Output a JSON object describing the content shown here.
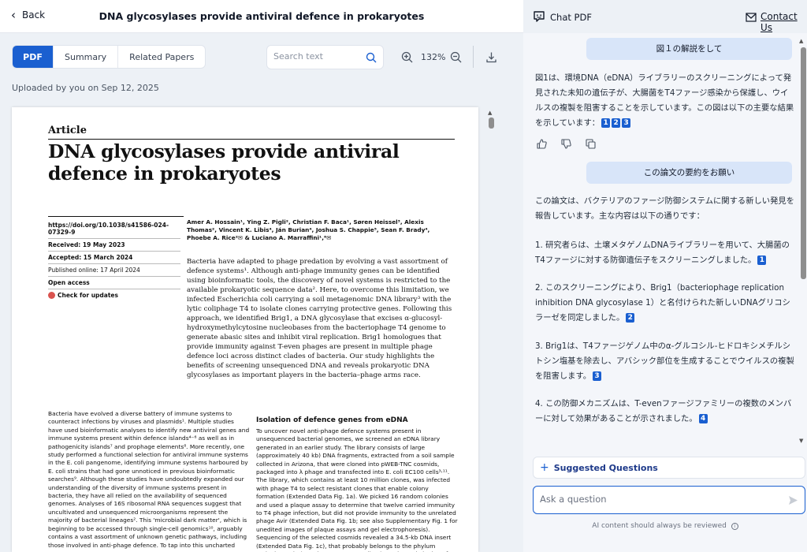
{
  "header": {
    "back_label": "Back",
    "doc_title": "DNA glycosylases provide antiviral defence in prokaryotes"
  },
  "tabs": [
    {
      "label": "PDF",
      "active": true
    },
    {
      "label": "Summary",
      "active": false
    },
    {
      "label": "Related Papers",
      "active": false
    }
  ],
  "toolbar": {
    "search_placeholder": "Search text",
    "zoom_level": "132%"
  },
  "uploaded_text": "Uploaded by you on Sep 12, 2025",
  "paper": {
    "article_label": "Article",
    "title": "DNA glycosylases provide antiviral defence in prokaryotes",
    "doi": "https://doi.org/10.1038/s41586-024-07329-9",
    "received": "Received: 19 May 2023",
    "accepted": "Accepted: 15 March 2024",
    "published": "Published online: 17 April 2024",
    "open_access": "Open access",
    "check_updates": "Check for updates",
    "authors": "Amer A. Hossain¹, Ying Z. Pigli², Christian F. Baca¹, Søren Heissel³, Alexis Thomas², Vincent K. Libis⁴, Ján Burian⁴, Joshua S. Chappie⁵, Sean F. Brady⁴, Phoebe A. Rice²✉ & Luciano A. Marraffini¹,⁶✉",
    "abstract": "Bacteria have adapted to phage predation by evolving a vast assortment of defence systems¹. Although anti-phage immunity genes can be identified using bioinformatic tools, the discovery of novel systems is restricted to the available prokaryotic sequence data². Here, to overcome this limitation, we infected Escherichia coli carrying a soil metagenomic DNA library³ with the lytic coliphage T4 to isolate clones carrying protective genes. Following this approach, we identified Brig1, a DNA glycosylase that excises α-glucosyl-hydroxymethylcytosine nucleobases from the bacteriophage T4 genome to generate abasic sites and inhibit viral replication. Brig1 homologues that provide immunity against T-even phages are present in multiple phage defence loci across distinct clades of bacteria. Our study highlights the benefits of screening unsequenced DNA and reveals prokaryotic DNA glycosylases as important players in the bacteria–phage arms race.",
    "col1": "Bacteria have evolved a diverse battery of immune systems to counteract infections by viruses and plasmids¹. Multiple studies have used bioinformatic analyses to identify new antiviral genes and immune systems present within defence islands⁴⁻⁶ as well as in pathogenicity islands⁷ and prophage elements⁸. More recently, one study performed a functional selection for antiviral immune systems in the E. coli pangenome, identifying immune systems harboured by E. coli strains that had gone unnoticed in previous bioinformatic searches⁹. Although these studies have undoubtedly expanded our understanding of the diversity of immune systems present in bacteria, they have all relied on the availability of sequenced genomes. Analyses of 16S ribosomal RNA sequences suggest that uncultivated and unsequenced microorganisms represent the majority of bacterial lineages². This 'microbial dark matter', which is beginning to be accessed through single-cell genomics¹⁰, arguably contains a vast assortment of unknown genetic pathways, including those involved in anti-phage defence. To tap into this uncharted sequence space,",
    "col2_heading": "Isolation of defence genes from eDNA",
    "col2": "To uncover novel anti-phage defence systems present in unsequenced bacterial genomes, we screened an eDNA library generated in an earlier study. The library consists of large (approximately 40 kb) DNA fragments, extracted from a soil sample collected in Arizona, that were cloned into pWEB-TNC cosmids, packaged into λ phage and transfected into E. coli EC100 cells³˒¹¹. The library, which contains at least 10 million clones, was infected with phage T4 to select resistant clones that enable colony formation (Extended Data Fig. 1a). We picked 16 random colonies and used a plaque assay to determine that twelve carried immunity to T4 phage infection, but did not provide immunity to the unrelated phage Avir (Extended Data Fig. 1b; see also Supplementary Fig. 1 for unedited images of plaque assays and gel electrophoresis). Sequencing of the selected cosmids revealed a 34.5-kb DNA insert (Extended Data Fig. 1c), that probably belongs to the phylum Actinobacteria (Supplementary Data File 1). Further subcloning of cosmid fragments (Extended Data"
  },
  "chat": {
    "title": "Chat PDF",
    "contact_label": "Contact Us",
    "user_msg_1": "図１の解説をして",
    "ai_msg_1": "図1は、環境DNA（eDNA）ライブラリーのスクリーニングによって発見された未知の遺伝子が、大腸菌をT4ファージ感染から保護し、ウイルスの複製を阻害することを示しています。この図は以下の主要な結果を示しています：",
    "ai_msg_1_cites": [
      "1",
      "2",
      "3"
    ],
    "user_msg_2": "この論文の要約をお願い",
    "ai_msg_2_intro": "この論文は、バクテリアのファージ防御システムに関する新しい発見を報告しています。主な内容は以下の通りです：",
    "points": [
      {
        "text": "1. 研究者らは、土壌メタゲノムDNAライブラリーを用いて、大腸菌のT4ファージに対する防御遺伝子をスクリーニングしました。",
        "cite": "1"
      },
      {
        "text": "2. このスクリーニングにより、Brig1（bacteriophage replication inhibition DNA glycosylase 1）と名付けられた新しいDNAグリコシラーゼを同定しました。",
        "cite": "2"
      },
      {
        "text": "3. Brig1は、T4ファージゲノム中のα-グルコシル-ヒドロキシメチルシトシン塩基を除去し、アバシック部位を生成することでウイルスの複製を阻害します。",
        "cite": "3"
      },
      {
        "text": "4. この防御メカニズムは、T-evenファージファミリーの複数のメンバーに対して効果があることが示されました。",
        "cite": "4"
      }
    ],
    "suggested_label": "Suggested Questions",
    "ask_placeholder": "Ask a question",
    "disclaimer": "AI content should always be reviewed"
  }
}
